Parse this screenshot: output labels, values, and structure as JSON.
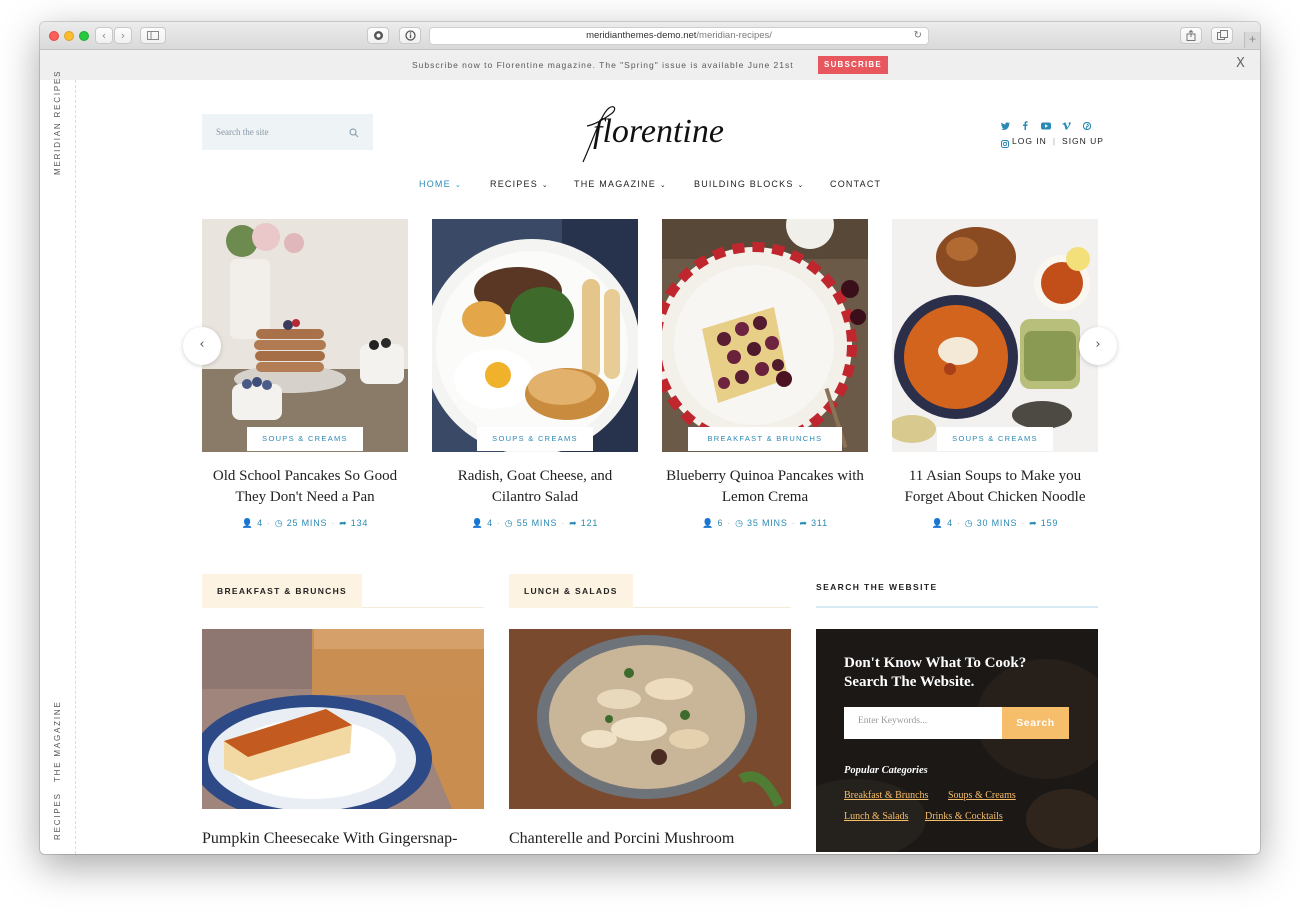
{
  "browser": {
    "url_host": "meridianthemes-demo.net",
    "url_path": "/meridian-recipes/"
  },
  "notice": {
    "text": "Subscribe now to Florentine magazine. The \"Spring\" issue is available June 21st",
    "button": "SUBSCRIBE",
    "close": "X"
  },
  "side_rail": {
    "top_label": "MERIDIAN RECIPES",
    "bottom_labels": [
      "THE MAGAZINE",
      "RECIPES"
    ]
  },
  "header": {
    "search_placeholder": "Search the site",
    "logo_text": "florentine",
    "login": "LOG IN",
    "separator": "|",
    "signup": "SIGN UP",
    "social_icons": [
      "twitter-icon",
      "facebook-icon",
      "youtube-icon",
      "vimeo-icon",
      "pinterest-icon",
      "instagram-icon"
    ]
  },
  "nav": {
    "items": [
      {
        "label": "HOME",
        "dropdown": true,
        "active": true
      },
      {
        "label": "RECIPES",
        "dropdown": true
      },
      {
        "label": "THE MAGAZINE",
        "dropdown": true
      },
      {
        "label": "BUILDING BLOCKS",
        "dropdown": true
      },
      {
        "label": "CONTACT",
        "dropdown": false
      }
    ]
  },
  "carousel": {
    "cards": [
      {
        "tag": "SOUPS & CREAMS",
        "title": "Old School Pancakes So Good They Don't Need a Pan",
        "servings": "4",
        "time": "25 MINS",
        "shares": "134"
      },
      {
        "tag": "SOUPS & CREAMS",
        "title": "Radish, Goat Cheese, and Cilantro Salad",
        "servings": "4",
        "time": "55 MINS",
        "shares": "121"
      },
      {
        "tag": "BREAKFAST & BRUNCHS",
        "title": "Blueberry Quinoa Pancakes with Lemon Crema",
        "servings": "6",
        "time": "35 MINS",
        "shares": "311"
      },
      {
        "tag": "SOUPS & CREAMS",
        "title": "11 Asian Soups to Make you Forget About Chicken Noodle",
        "servings": "4",
        "time": "30 MINS",
        "shares": "159"
      }
    ],
    "prev": "‹",
    "next": "›"
  },
  "sections": {
    "breakfast": {
      "label": "BREAKFAST & BRUNCHS",
      "post_title": "Pumpkin Cheesecake With Gingersnap-"
    },
    "lunch": {
      "label": "LUNCH & SALADS",
      "post_title": "Chanterelle and Porcini Mushroom"
    }
  },
  "widget": {
    "heading": "SEARCH THE WEBSITE",
    "title_line1": "Don't Know What To Cook?",
    "title_line2": "Search The Website.",
    "input_placeholder": "Enter Keywords...",
    "button": "Search",
    "popular_title": "Popular Categories",
    "links": [
      "Breakfast & Brunchs",
      "Soups & Creams",
      "Lunch & Salads",
      "Drinks & Cocktails"
    ]
  },
  "colors": {
    "accent": "#2b8ab4",
    "subscribe": "#e8575d",
    "section_tab": "#fdf3e3",
    "widget_button": "#f6bd6b"
  }
}
